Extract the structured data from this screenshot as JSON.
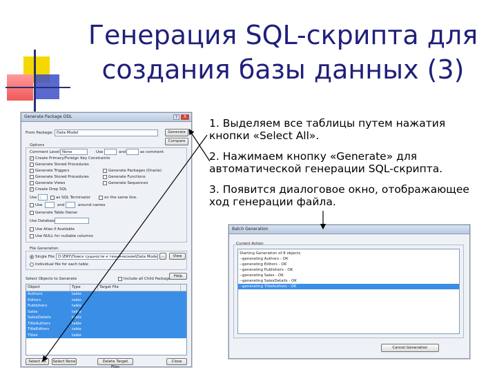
{
  "slide": {
    "title_line1": "Генерация SQL-скрипта для",
    "title_line2": "создания базы данных (3)",
    "bullets": [
      "1. Выделяем все таблицы путем нажатия кнопки «Select All».",
      "2. Нажимаем кнопку «Generate» для автоматической генерации SQL-скрипта.",
      "3. Появится диалоговое окно, отображающее ход генерации файла."
    ]
  },
  "generate_dialog": {
    "title": "Generate Package DDL",
    "help_glyph": "?",
    "close_glyph": "X",
    "from_package_label": "From Package:",
    "from_package_value": "Data Model",
    "generate_button": "Generate",
    "compare_button": "Compare",
    "options_label": "Options",
    "comment_level_label": "Comment Level",
    "comment_level_value": "None",
    "use_label": "Use",
    "and_label": "and",
    "as_comment_label": "as comment",
    "checkboxes_left": [
      {
        "label": "Create Primary/Foreign Key Constraints",
        "checked": true
      },
      {
        "label": "Generate Stored Procedures",
        "checked": false
      },
      {
        "label": "Generate Triggers",
        "checked": false
      },
      {
        "label": "Generate Stored Procedures",
        "checked": false
      },
      {
        "label": "Generate Views",
        "checked": false
      },
      {
        "label": "Create Drop SQL",
        "checked": true
      }
    ],
    "checkboxes_right": [
      {
        "label": "Generate Packages (Oracle)",
        "checked": false
      },
      {
        "label": "Generate Functions",
        "checked": false
      },
      {
        "label": "Generate Sequences",
        "checked": false
      }
    ],
    "use_terminator_row": {
      "use": "Use",
      "value": ";",
      "as_terminator": "as SQL Terminator",
      "on_same_line": "on the same line."
    },
    "use_names_row": {
      "use": "Use",
      "and": "and",
      "around_names": "around names"
    },
    "generate_table_owner": "Generate Table Owner",
    "use_database": "Use Database",
    "use_alias": "Use Alias if Available",
    "use_null": "Use NULL for nullable columns",
    "file_generation_label": "File Generation",
    "single_file": "Single File",
    "single_file_path": "D:\\ERY\\Поиск сущности к техническим\\Data Model.DDL",
    "browse_glyph": "...",
    "view_button": "View",
    "individual_file": "Individual file for each table",
    "select_objects_label": "Select Objects to Generate",
    "include_child_packages": "Include all Child Packages",
    "help_button": "Help",
    "columns": [
      "Object",
      "Type",
      "Target File"
    ],
    "rows": [
      [
        "Authors",
        "table",
        ""
      ],
      [
        "Editors",
        "table",
        ""
      ],
      [
        "Publishers",
        "table",
        ""
      ],
      [
        "Sales",
        "table",
        ""
      ],
      [
        "SalesDetails",
        "table",
        ""
      ],
      [
        "TitleAuthors",
        "table",
        ""
      ],
      [
        "TitleEditors",
        "table",
        ""
      ],
      [
        "Titles",
        "table",
        ""
      ]
    ],
    "select_all_button": "Select All",
    "select_none_button": "Select None",
    "delete_target_files_button": "Delete Target Files",
    "close_button": "Close"
  },
  "batch_dialog": {
    "title": "Batch Generation",
    "current_action_label": "Current Action",
    "log": [
      "Starting Generation of 8 objects",
      "--generating Authors - OK",
      "--generating Editors - OK",
      "--generating Publishers - OK",
      "--generating Sales - OK",
      "--generating SalesDetails - OK",
      "--generating TitleAuthors - OK"
    ],
    "selected_line": 6,
    "cancel_button": "Cancel Generation"
  },
  "colors": {
    "title": "#1f1f7a",
    "selection": "#3a8ee6",
    "deco_yellow": "#f5d800",
    "deco_red": "#f05a5a",
    "deco_blue": "#3c4fc8"
  }
}
